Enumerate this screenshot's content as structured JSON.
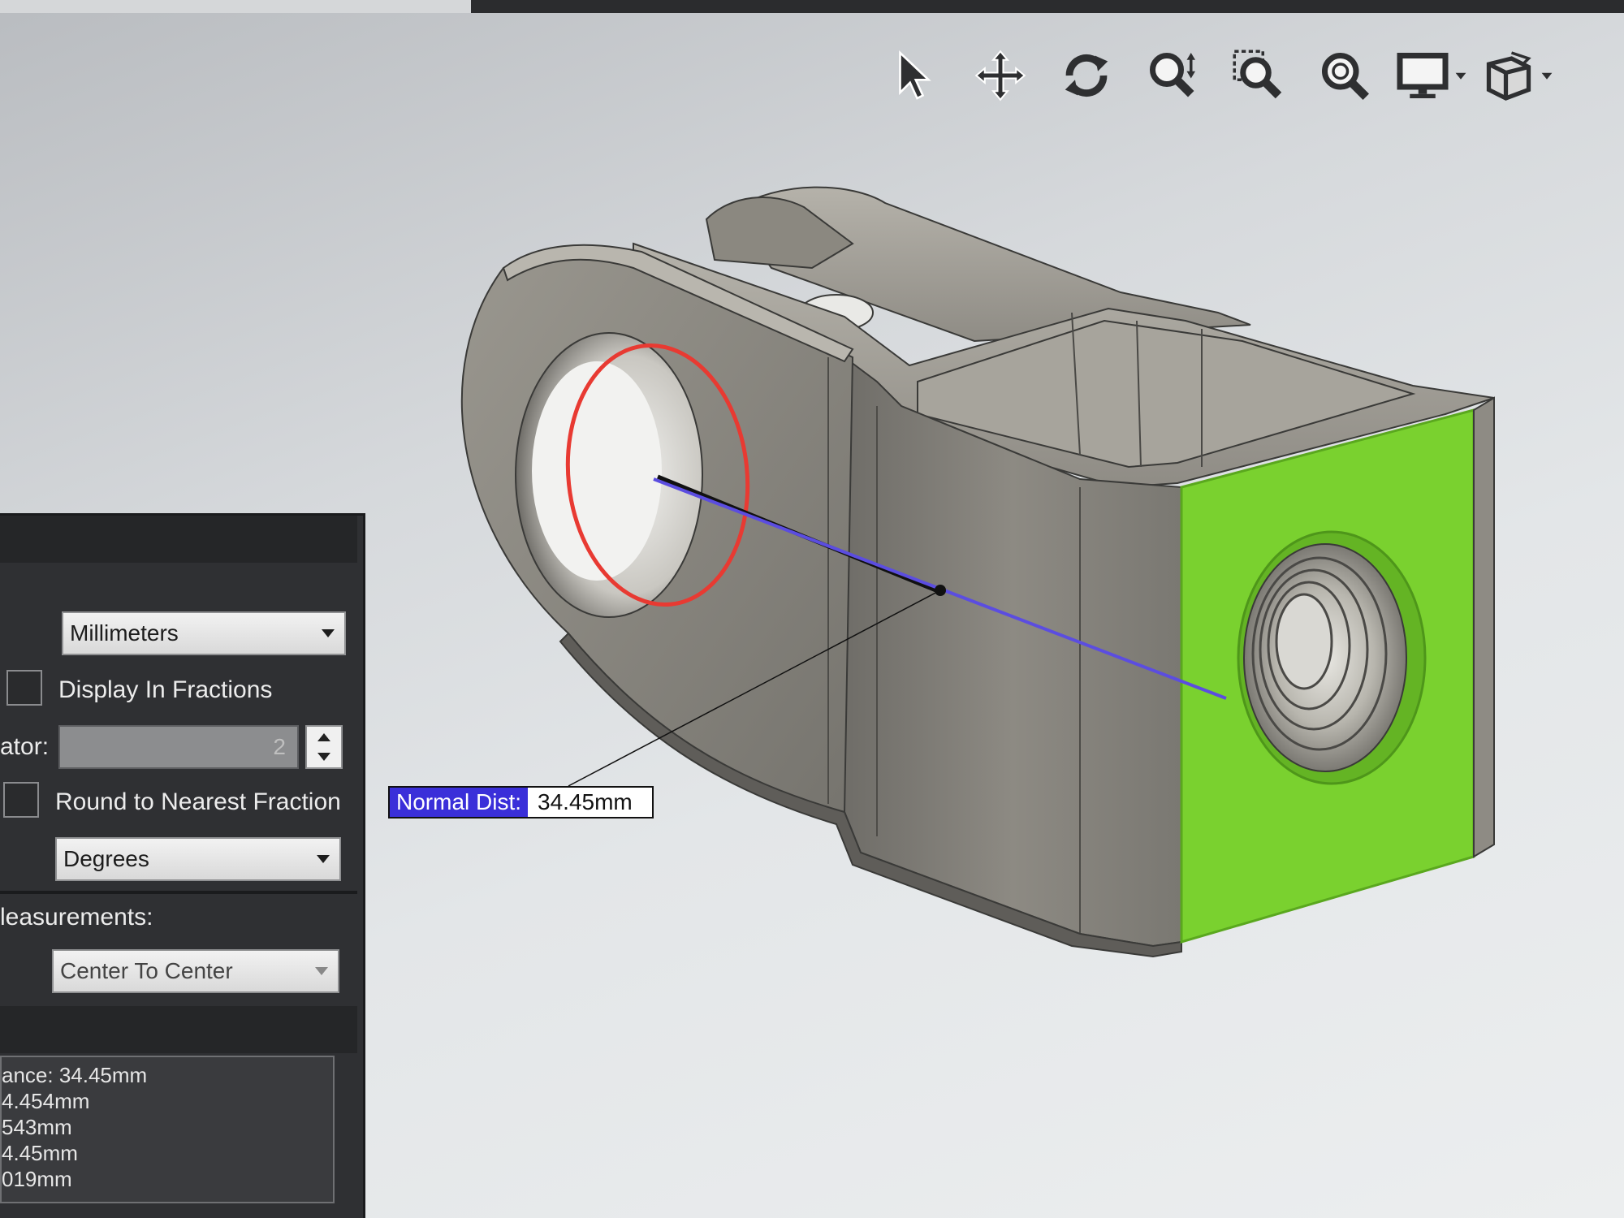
{
  "toolbar": {
    "tools": [
      {
        "icon": "select-arrow-icon"
      },
      {
        "icon": "pan-move-icon"
      },
      {
        "icon": "rotate-icon"
      },
      {
        "icon": "zoom-dynamic-icon"
      },
      {
        "icon": "zoom-window-icon"
      },
      {
        "icon": "zoom-fit-icon"
      },
      {
        "icon": "display-monitor-icon",
        "has_dropdown": true
      },
      {
        "icon": "view-cube-icon",
        "has_dropdown": true
      }
    ]
  },
  "callout": {
    "key": "Normal Dist:",
    "value": "34.45mm"
  },
  "panel": {
    "units_select": "Millimeters",
    "display_in_fractions_label": "Display In Fractions",
    "denominator_label": "ator:",
    "denominator_value": "2",
    "round_label": "Round to Nearest Fraction",
    "angle_select": "Degrees",
    "measurements_label": "leasurements:",
    "arc_select": "Center To Center",
    "results": [
      "ance: 34.45mm",
      "4.454mm",
      "543mm",
      "4.45mm",
      "019mm"
    ]
  },
  "colors": {
    "selected_face": "#7ad12f",
    "selected_edge": "#e83a32",
    "measure_line": "#5b4de0",
    "model_body": "#8f8c85"
  }
}
